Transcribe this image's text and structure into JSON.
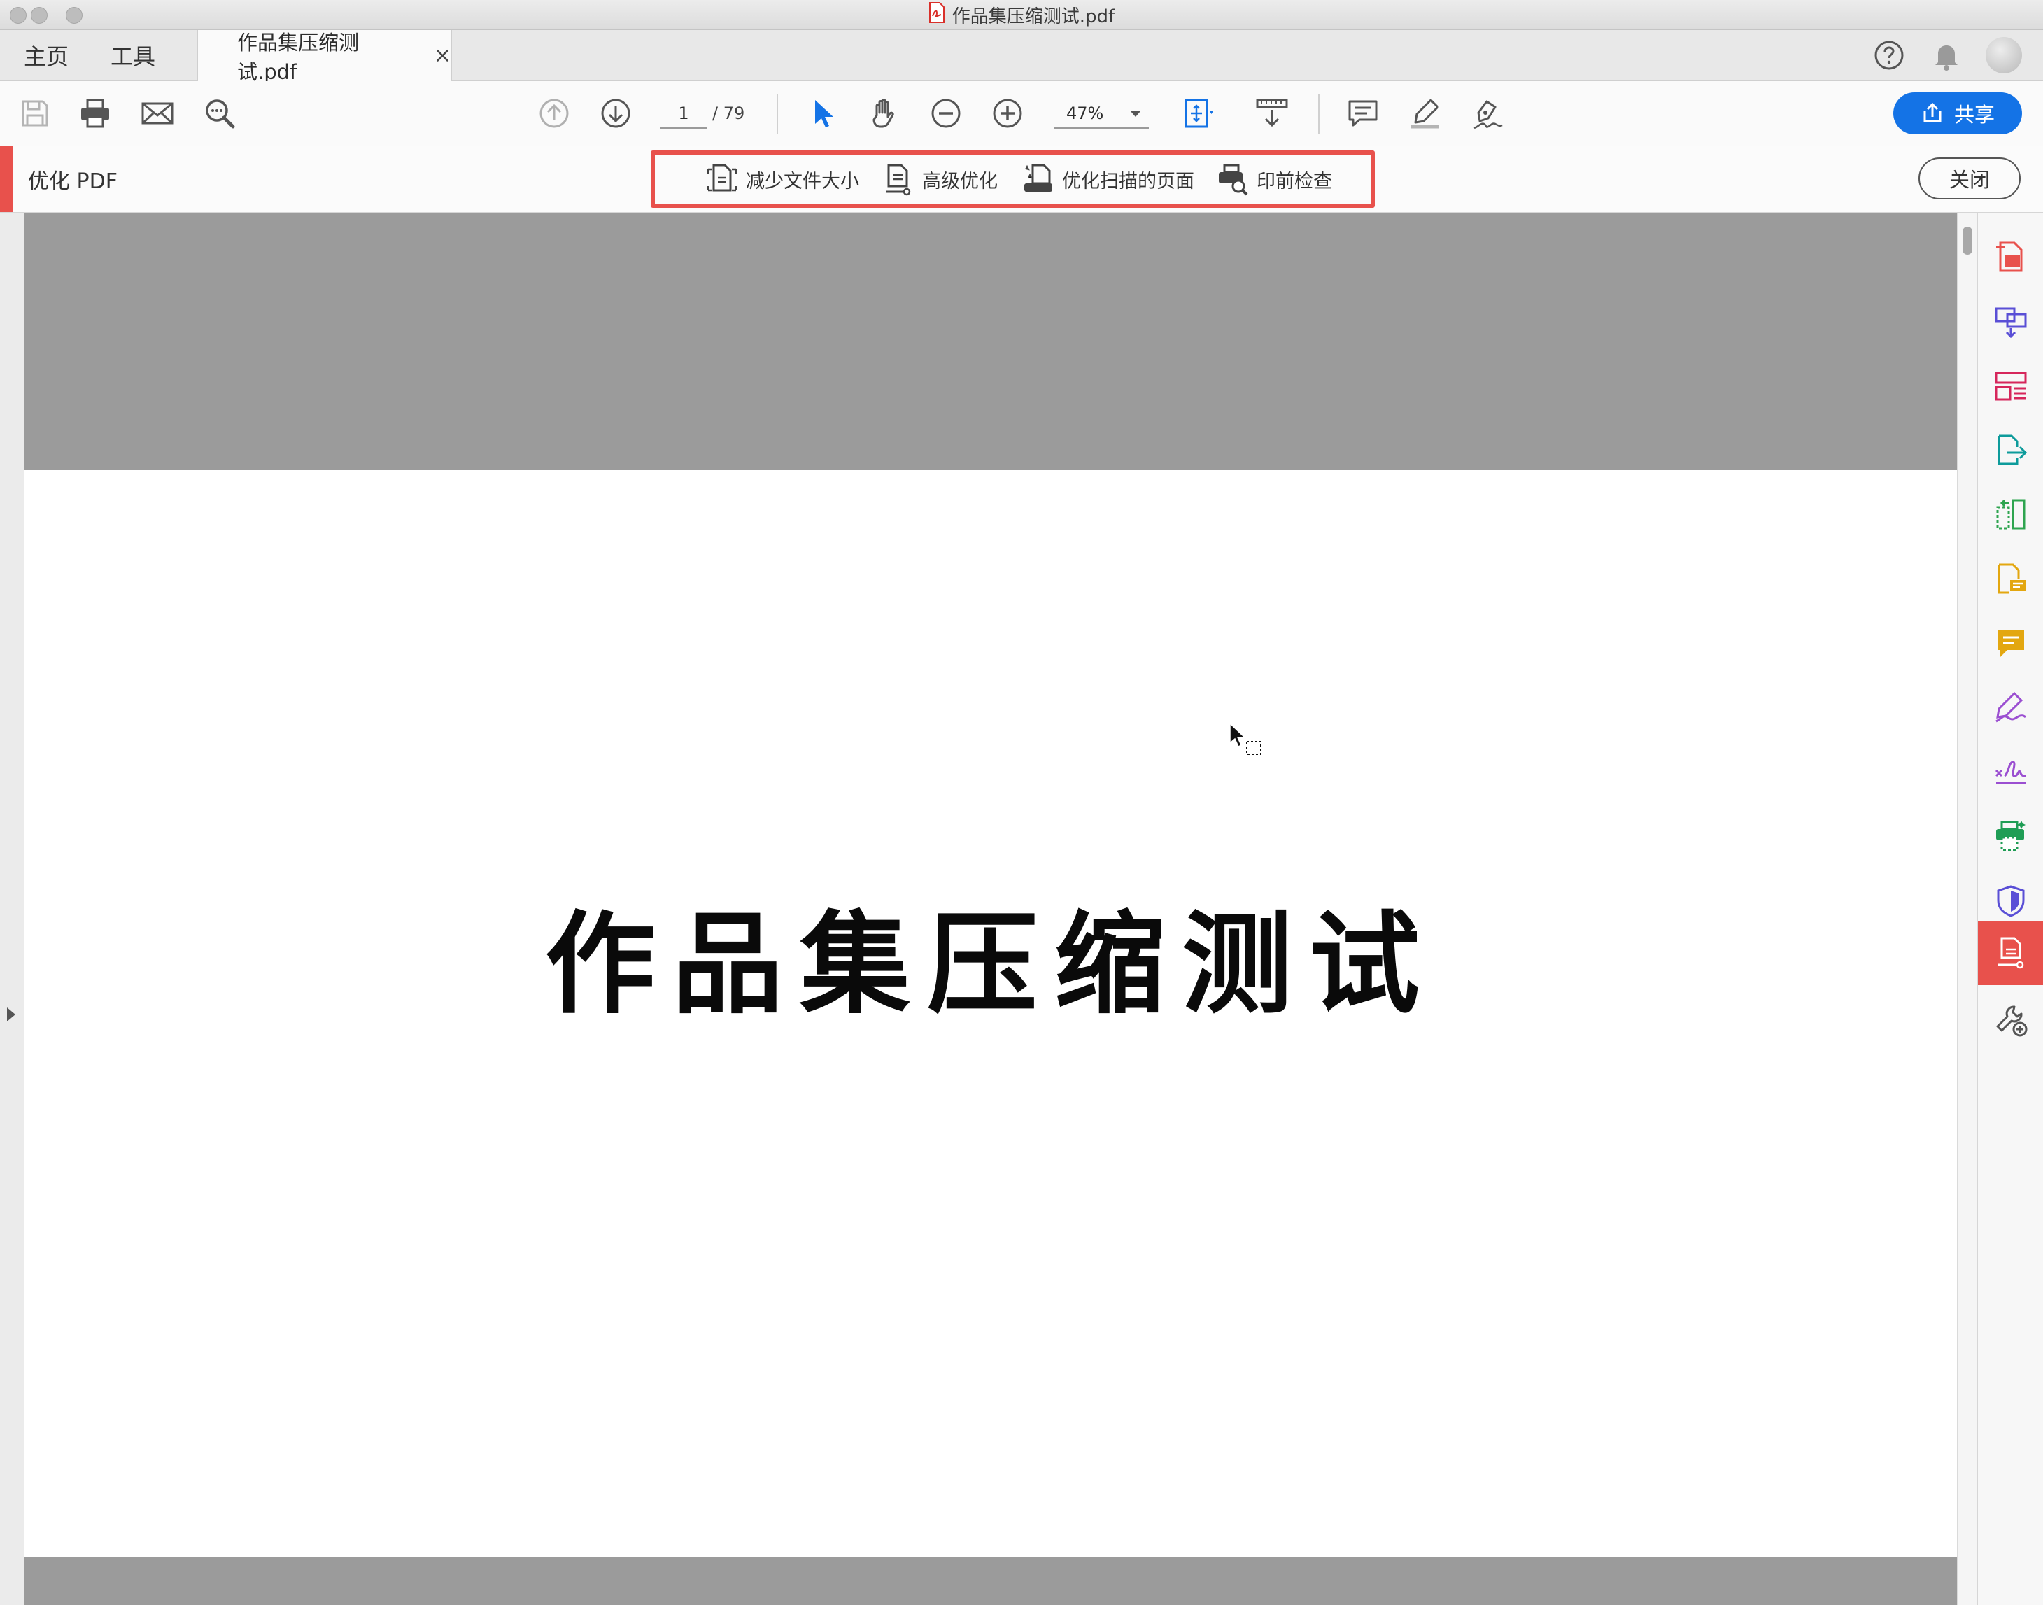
{
  "window": {
    "title": "作品集压缩测试.pdf"
  },
  "tabs": {
    "home": "主页",
    "tools": "工具",
    "document": "作品集压缩测试.pdf",
    "close_glyph": "×"
  },
  "toolbar": {
    "page_current": "1",
    "page_total": "/ 79",
    "zoom": "47%",
    "share_label": "共享"
  },
  "optimize_bar": {
    "title": "优化 PDF",
    "tools": [
      "减少文件大小",
      "高级优化",
      "优化扫描的页面",
      "印前检查"
    ],
    "close_label": "关闭",
    "accent_color": "#e8514c"
  },
  "document": {
    "title": "作品集压缩测试"
  },
  "right_panel": {
    "icons": [
      "create-pdf-icon",
      "combine-files-icon",
      "organize-pages-icon",
      "export-pdf-icon",
      "edit-pdf-icon",
      "request-signature-icon",
      "comment-icon",
      "fill-sign-icon",
      "certificate-icon",
      "print-production-icon",
      "protect-icon",
      "optimize-pdf-icon",
      "more-tools-icon"
    ],
    "active": "optimize-pdf-icon"
  }
}
